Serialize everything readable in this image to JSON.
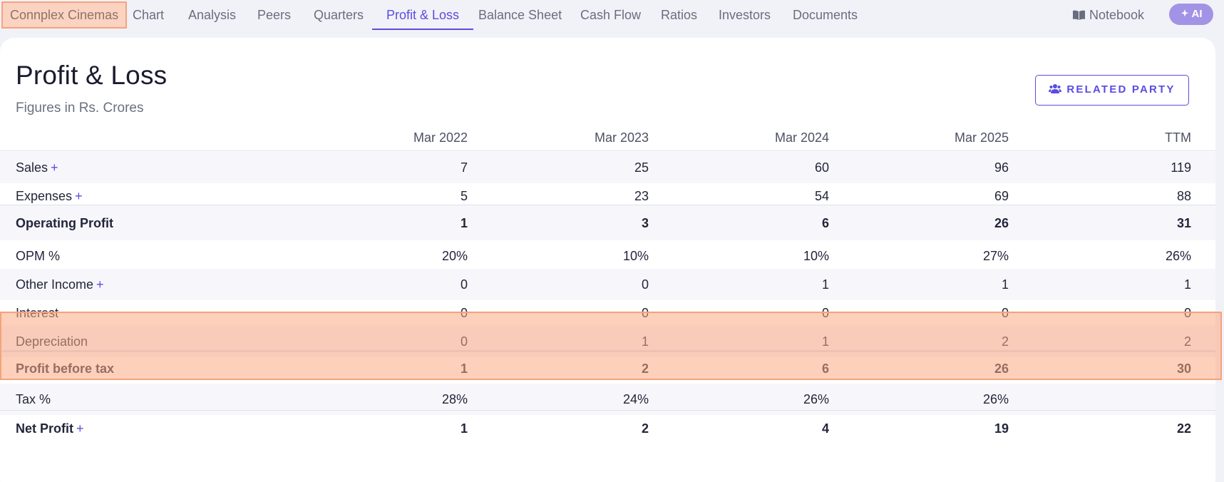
{
  "nav": {
    "company": "Connplex Cinemas",
    "tabs": [
      "Chart",
      "Analysis",
      "Peers",
      "Quarters",
      "Profit & Loss",
      "Balance Sheet",
      "Cash Flow",
      "Ratios",
      "Investors",
      "Documents"
    ],
    "active_tab": "Profit & Loss",
    "notebook": "Notebook",
    "ai": "AI"
  },
  "section": {
    "title": "Profit & Loss",
    "subtitle": "Figures in Rs. Crores",
    "related_party": "RELATED PARTY"
  },
  "table": {
    "columns": [
      "Mar 2022",
      "Mar 2023",
      "Mar 2024",
      "Mar 2025",
      "TTM"
    ],
    "rows": [
      {
        "label": "Sales",
        "plus": "+",
        "values": [
          "7",
          "25",
          "60",
          "96",
          "119"
        ]
      },
      {
        "label": "Expenses",
        "plus": "+",
        "values": [
          "5",
          "23",
          "54",
          "69",
          "88"
        ]
      },
      {
        "label": "Operating Profit",
        "plus": "",
        "values": [
          "1",
          "3",
          "6",
          "26",
          "31"
        ]
      },
      {
        "label": "OPM %",
        "plus": "",
        "values": [
          "20%",
          "10%",
          "10%",
          "27%",
          "26%"
        ]
      },
      {
        "label": "Other Income",
        "plus": "+",
        "values": [
          "0",
          "0",
          "1",
          "1",
          "1"
        ]
      },
      {
        "label": "Interest",
        "plus": "",
        "values": [
          "0",
          "0",
          "0",
          "0",
          "0"
        ]
      },
      {
        "label": "Depreciation",
        "plus": "",
        "values": [
          "0",
          "1",
          "1",
          "2",
          "2"
        ]
      },
      {
        "label": "Profit before tax",
        "plus": "",
        "values": [
          "1",
          "2",
          "6",
          "26",
          "30"
        ]
      },
      {
        "label": "Tax %",
        "plus": "",
        "values": [
          "28%",
          "24%",
          "26%",
          "26%",
          ""
        ]
      },
      {
        "label": "Net Profit",
        "plus": "+",
        "values": [
          "1",
          "2",
          "4",
          "19",
          "22"
        ]
      }
    ]
  },
  "colors": {
    "accent": "#5a4ce0",
    "highlight": "#f6a27c",
    "ai_button": "#a393e6"
  }
}
